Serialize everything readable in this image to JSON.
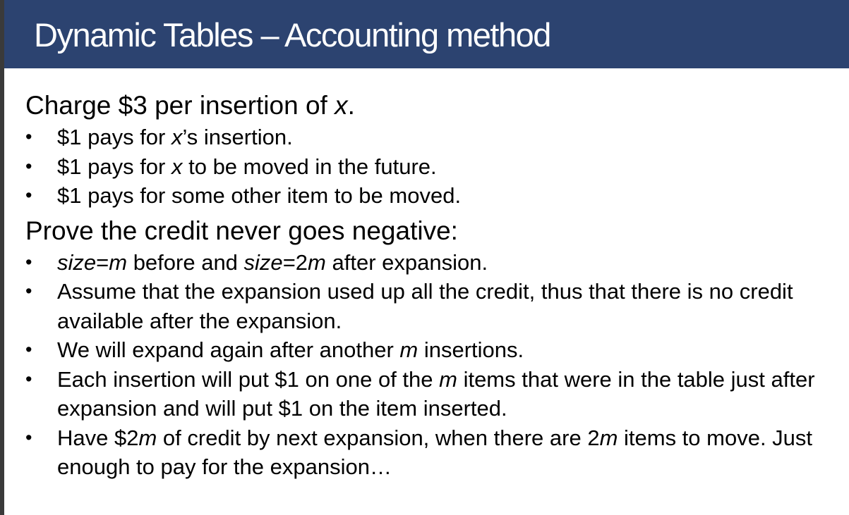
{
  "colors": {
    "title_bar": "#2c4370",
    "title_text": "#ffffff",
    "body_text": "#000000",
    "left_edge": "#3a3a3a"
  },
  "slide": {
    "title": "Dynamic Tables – Accounting method",
    "section1": {
      "heading": {
        "pre": "Charge $3 per insertion of ",
        "em": "x",
        "post": "."
      },
      "bullets": [
        {
          "t1": "$1 pays for ",
          "i1": "x",
          "t2": "’s insertion."
        },
        {
          "t1": "$1 pays for ",
          "i1": "x",
          "t2": " to be moved in the future."
        },
        {
          "t1": "$1 pays for some other item to be moved."
        }
      ]
    },
    "section2": {
      "heading": "Prove the credit never goes negative:",
      "bullets": [
        {
          "i1": "size",
          "t1": "=",
          "i2": "m",
          "t2": " before and ",
          "i3": "size",
          "t3": "=2",
          "i4": "m",
          "t4": " after expansion."
        },
        {
          "t1": "Assume that the expansion used up all the credit, thus that there is no credit available after the expansion."
        },
        {
          "t1": "We will expand again after another ",
          "i1": "m",
          "t2": " insertions."
        },
        {
          "t1": "Each insertion will put $1 on one of the ",
          "i1": "m",
          "t2": " items that were in the table just after expansion and will put $1 on the item inserted."
        },
        {
          "t1": "Have $2",
          "i1": "m",
          "t2": " of credit by next expansion, when there are 2",
          "i2": "m",
          "t3": " items to move. Just enough to pay for the expansion…"
        }
      ]
    }
  },
  "icons": {
    "bullet": "bullet-dot-icon"
  }
}
